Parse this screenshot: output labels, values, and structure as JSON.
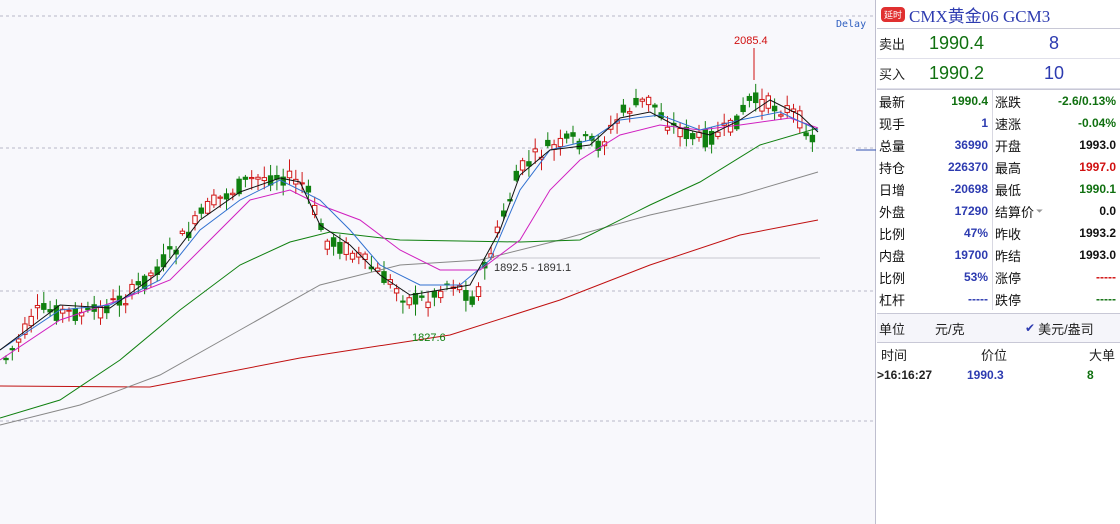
{
  "chart": {
    "delay_label": "Delay",
    "high_label": "2085.4",
    "low_label": "1827.6",
    "range_label": "1892.5 - 1891.1",
    "colors": {
      "up": "#d01818",
      "down": "#108010",
      "ma5": "#111111",
      "ma10": "#3070d0",
      "ma20": "#d020c0",
      "ma60": "#108010",
      "ma120": "#888888",
      "ma250": "#c01010"
    }
  },
  "quote": {
    "badge": "延时",
    "title": "CMX黄金06  GCM3",
    "ask": {
      "label": "卖出",
      "price": "1990.4",
      "volume": "8"
    },
    "bid": {
      "label": "买入",
      "price": "1990.2",
      "volume": "10"
    },
    "left_rows": [
      {
        "label": "最新",
        "value": "1990.4",
        "color": "green"
      },
      {
        "label": "现手",
        "value": "1",
        "color": "blue"
      },
      {
        "label": "总量",
        "value": "36990",
        "color": "blue"
      },
      {
        "label": "持仓",
        "value": "226370",
        "color": "blue"
      },
      {
        "label": "日增",
        "value": "-20698",
        "color": "blue"
      },
      {
        "label": "外盘",
        "value": "17290",
        "color": "blue"
      },
      {
        "label": "比例",
        "value": "47%",
        "color": "blue"
      },
      {
        "label": "内盘",
        "value": "19700",
        "color": "blue"
      },
      {
        "label": "比例",
        "value": "53%",
        "color": "blue"
      },
      {
        "label": "杠杆",
        "value": "-----",
        "color": "blue"
      }
    ],
    "right_rows": [
      {
        "label": "涨跌",
        "value": "-2.6/0.13%",
        "color": "green"
      },
      {
        "label": "速涨",
        "value": "-0.04%",
        "color": "green"
      },
      {
        "label": "开盘",
        "value": "1993.0",
        "color": "black"
      },
      {
        "label": "最高",
        "value": "1997.0",
        "color": "red"
      },
      {
        "label": "最低",
        "value": "1990.1",
        "color": "green"
      },
      {
        "label": "结算价",
        "value": "0.0",
        "color": "black"
      },
      {
        "label": "昨收",
        "value": "1993.2",
        "color": "black"
      },
      {
        "label": "昨结",
        "value": "1993.0",
        "color": "black"
      },
      {
        "label": "涨停",
        "value": "-----",
        "color": "red"
      },
      {
        "label": "跌停",
        "value": "-----",
        "color": "green"
      }
    ],
    "unit": {
      "label": "单位",
      "value": "元/克",
      "option": "美元/盎司",
      "checked": true
    },
    "ticks": {
      "headers": [
        "时间",
        "价位",
        "大单"
      ],
      "rows": [
        {
          "time": ">16:16:27",
          "price": "1990.3",
          "size": "8"
        }
      ]
    }
  }
}
